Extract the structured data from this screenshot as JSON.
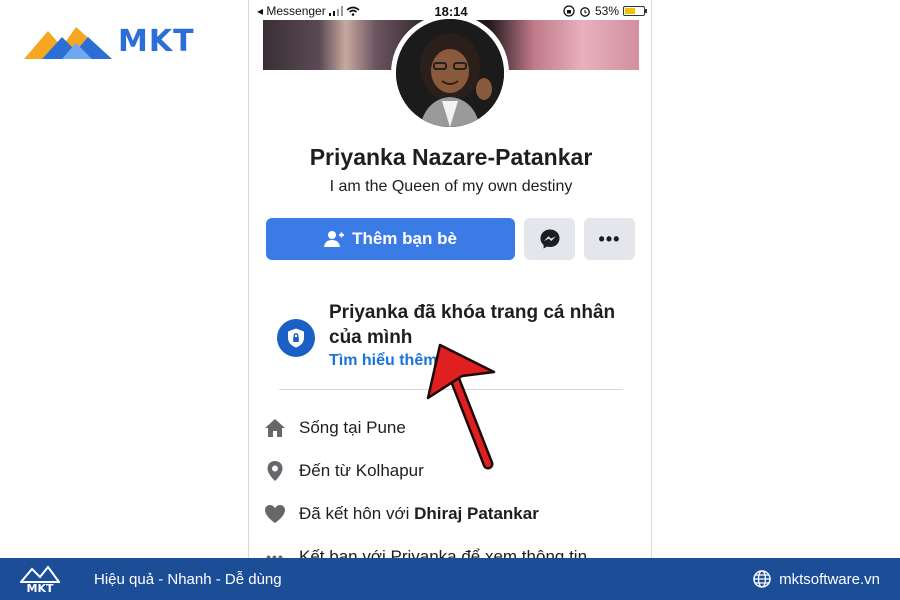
{
  "brand": {
    "logo_text": "MKT",
    "colors": {
      "blue": "#2b6fd6",
      "orange": "#f5a623",
      "footer": "#1c4e98"
    }
  },
  "status_bar": {
    "back_app": "◂ Messenger",
    "time": "18:14",
    "battery": "53%",
    "battery_level": 0.53
  },
  "profile": {
    "name": "Priyanka Nazare-Patankar",
    "bio": "I am the Queen of my own destiny"
  },
  "actions": {
    "add_friend_label": "Thêm bạn bè",
    "add_friend_icon": "add-friend-icon",
    "messenger_icon": "messenger-icon",
    "more_icon": "more-icon"
  },
  "lock_notice": {
    "icon": "shield-lock-icon",
    "title": "Priyanka đã khóa trang cá nhân của mình",
    "link": "Tìm hiểu thêm"
  },
  "info": [
    {
      "icon": "home-icon",
      "prefix": "Sống tại ",
      "value": "Pune"
    },
    {
      "icon": "location-pin-icon",
      "prefix": "Đến từ ",
      "value": "Kolhapur"
    },
    {
      "icon": "heart-icon",
      "prefix": "Đã kết hôn với ",
      "value": "Dhiraj Patankar"
    },
    {
      "icon": "more-icon",
      "prefix": "Kết bạn với Priyanka để xem thông tin",
      "value": ""
    }
  ],
  "footer": {
    "logo_text": "MKT",
    "slogan": "Hiệu quả - Nhanh - Dễ dùng",
    "website": "mktsoftware.vn"
  }
}
